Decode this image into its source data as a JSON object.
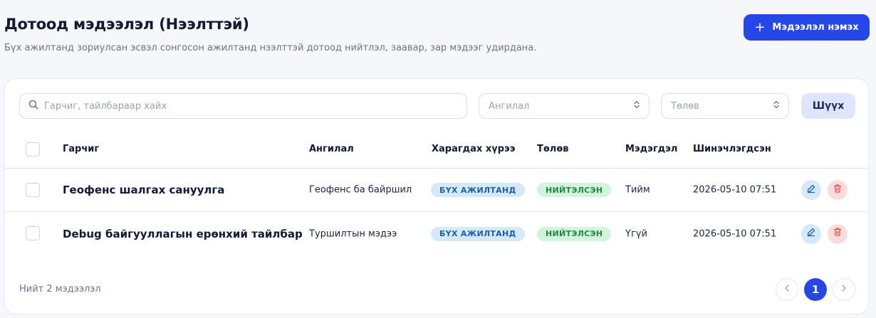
{
  "header": {
    "title": "Дотоод мэдээлэл (Нээлттэй)",
    "subtitle": "Бүх ажилтанд зориулсан эсвэл сонгосон ажилтанд нээлттэй дотоод нийтлэл, заавар, зар мэдээг удирдана.",
    "add_button_label": "Мэдээлэл нэмэх"
  },
  "filters": {
    "search_placeholder": "Гарчиг, тайлбараар хайх",
    "search_value": "",
    "category_placeholder": "Ангилал",
    "status_placeholder": "Төлөв",
    "filter_button_label": "Шүүх"
  },
  "table": {
    "columns": [
      "Гарчиг",
      "Ангилал",
      "Харагдах хүрээ",
      "Төлөв",
      "Мэдэгдэл",
      "Шинэчлэгдсэн"
    ],
    "rows": [
      {
        "title": "Геофенс шалгах сануулга",
        "category": "Геофенс ба байршил",
        "audience": "БҮХ АЖИЛТАНД",
        "status": "НИЙТЭЛСЭН",
        "notify": "Тийм",
        "updated": "2026-05-10 07:51"
      },
      {
        "title": "Debug байгууллагын ерөнхий тайлбар",
        "category": "Туршилтын мэдээ",
        "audience": "БҮХ АЖИЛТАНД",
        "status": "НИЙТЭЛСЭН",
        "notify": "Үгүй",
        "updated": "2026-05-10 07:51"
      }
    ]
  },
  "footer": {
    "total_text": "Нийт 2 мэдээлэл",
    "current_page": "1"
  },
  "colors": {
    "accent": "#2547e8",
    "audience_badge": "#d5e9fb",
    "status_badge": "#d3f3dc",
    "delete": "#e05252"
  },
  "icons": [
    "plus-icon",
    "search-icon",
    "chevron-updown-icon",
    "edit-icon",
    "trash-icon",
    "chevron-left-icon",
    "chevron-right-icon"
  ]
}
